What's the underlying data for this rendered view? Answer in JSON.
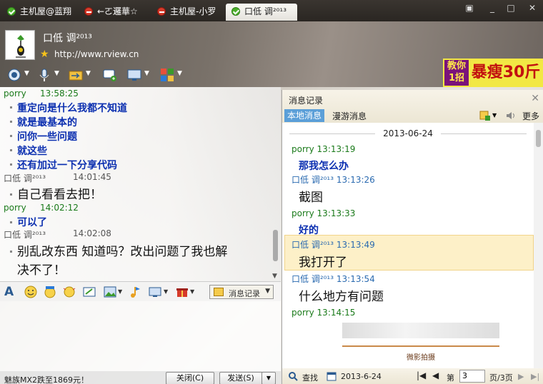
{
  "tabs": [
    {
      "label": "主机屋@蓝翔",
      "status": "online"
    },
    {
      "label": "←ㄛ邏華☆",
      "status": "busy"
    },
    {
      "label": "主机屋-小罗",
      "status": "busy"
    },
    {
      "label": "口低 调²⁰¹³",
      "status": "online",
      "active": true
    }
  ],
  "window": {
    "menu_icon": "menu-icon",
    "minimize": "_",
    "maximize": "□",
    "close": "✕"
  },
  "contact": {
    "nickname": "口低 调²⁰¹³",
    "url": "http://www.rview.cn"
  },
  "ad": {
    "line1": "教你",
    "line2": "1招",
    "text": "暴瘦30斤"
  },
  "chat": {
    "messages": [
      {
        "sender": "porry",
        "time": "13:58:25",
        "lines": [
          "重定向是什么我都不知道",
          "就是最基本的",
          "问你一些问题",
          "就这些",
          "还有加过一下分享代码"
        ]
      },
      {
        "sender": "口低 调²⁰¹³",
        "time": "14:01:45",
        "lines": [
          "自己看看去把！"
        ]
      },
      {
        "sender": "porry",
        "time": "14:02:12",
        "lines": [
          "可以了"
        ]
      },
      {
        "sender": "口低 调²⁰¹³",
        "time": "14:02:08",
        "lines": [
          "别乱改东西  知道吗？改出问题了我也解",
          "决不了！"
        ]
      }
    ]
  },
  "format_bar": {
    "history_button": "消息记录"
  },
  "bottom": {
    "ad_text": "魅族MX2跌至1869元！",
    "close_button": "关闭(C)",
    "send_button": "发送(S)"
  },
  "history": {
    "title": "消息记录",
    "tab_local": "本地消息",
    "tab_roaming": "漫游消息",
    "more": "更多",
    "date": "2013-06-24",
    "entries": [
      {
        "sender": "porry",
        "time": "13:13:19",
        "text": "那我怎么办"
      },
      {
        "sender": "口低 调²⁰¹³",
        "time": "13:13:26",
        "text": "截图"
      },
      {
        "sender": "porry",
        "time": "13:13:33",
        "text": "好的"
      },
      {
        "sender": "口低 调²⁰¹³",
        "time": "13:13:49",
        "text": "我打开了",
        "highlighted": true
      },
      {
        "sender": "口低 调²⁰¹³",
        "time": "13:13:54",
        "text": "什么地方有问题"
      },
      {
        "sender": "porry",
        "time": "13:14:15",
        "text": ""
      }
    ],
    "thumbnail_caption": "微影拍摄",
    "footer": {
      "search": "查找",
      "date": "2013-6-24",
      "page_label": "第",
      "page": "3",
      "page_suffix": "页/3页"
    }
  }
}
